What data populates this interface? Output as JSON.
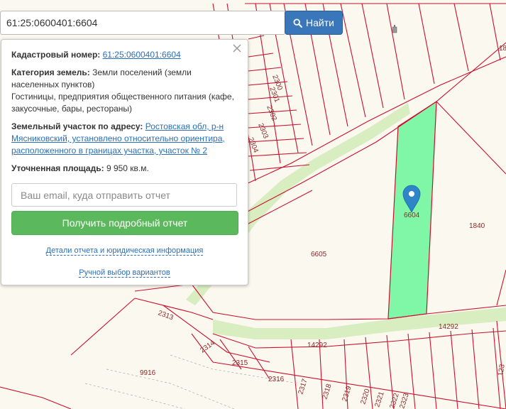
{
  "search": {
    "value": "61:25:0600401:6604",
    "button_label": "Найти"
  },
  "info": {
    "cad_label": "Кадастровый номер:",
    "cad_value": "61:25:0600401:6604",
    "category_label": "Категория земель:",
    "category_value": "Земли поселений (земли населенных пунктов)",
    "usage_value": "Гостиницы, предприятия общественного питания (кафе, закусочные, бары, рестораны)",
    "address_label": "Земельный участок по адресу:",
    "address_value": "Ростовская обл, р-н Мясниковский, установлено относительно ориентира, расположенного в границах участка, участок № 2",
    "area_label": "Уточненная площадь:",
    "area_value": "9 950 кв.м.",
    "email_placeholder": "Ваш email, куда отправить отчет",
    "report_button": "Получить подробный отчет",
    "details_link": "Детали отчета и юридическая информация",
    "manual_link": "Ручной выбор вариантов"
  },
  "map": {
    "parcel_labels": {
      "p2300": "2300",
      "p2301": "2301",
      "p2302": "2302",
      "p2303": "2303",
      "p2304": "2304",
      "p6604": "6604",
      "p6605": "6605",
      "p1840": "1840",
      "p14292a": "14292",
      "p14292b": "14292",
      "p2313": "2313",
      "p2314": "2314",
      "p2315": "2315",
      "p2316": "2316",
      "p2317": "2317",
      "p2318": "2318",
      "p2319": "2319",
      "p2320": "2320",
      "p2321": "2321",
      "p2322": "2322",
      "p2323": "2323",
      "p9916": "9916",
      "p18": "18",
      "p123": "123"
    },
    "colors": {
      "background": "#fbf8ef",
      "parcel_border": "#c8102e",
      "road": "#d8edc0",
      "selected_parcel": "#7ff7a7",
      "marker": "#2e86c8"
    }
  }
}
